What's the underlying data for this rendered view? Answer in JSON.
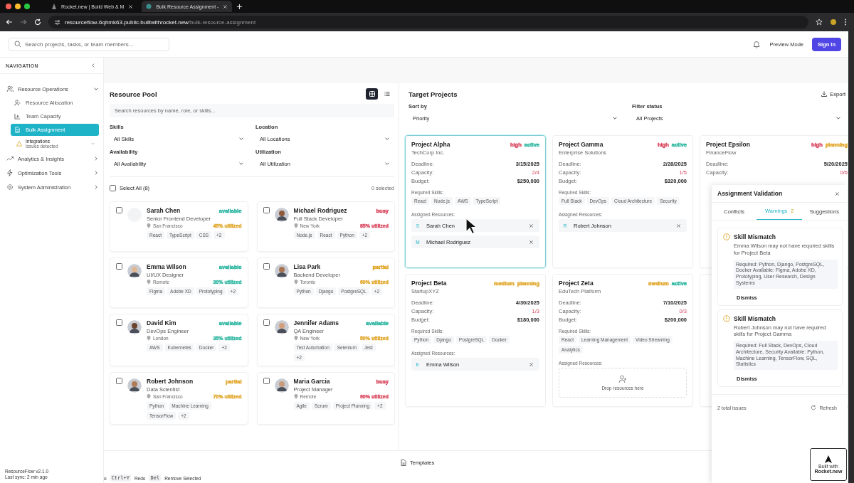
{
  "browser": {
    "tabs": [
      {
        "title": "Rocket.new | Build Web & M",
        "selected": false
      },
      {
        "title": "Bulk Resource Assignment -",
        "selected": true
      }
    ],
    "url_host": "resourceflow-6qhmk63.public.builtwithrocket.new",
    "url_path": "/bulk-resource-assignment"
  },
  "header": {
    "search_placeholder": "Search projects, tasks, or team members...",
    "preview_label": "Preview Mode",
    "sign_in": "Sign In"
  },
  "sidebar": {
    "heading": "NAVIGATION",
    "items": [
      {
        "label": "Resource Operations",
        "expanded": true,
        "children": [
          {
            "label": "Resource Allocation",
            "selected": false
          },
          {
            "label": "Team Capacity",
            "selected": false
          },
          {
            "label": "Bulk Assignment",
            "selected": true
          }
        ],
        "notice": {
          "title": "Integrations",
          "subtitle": "Issues detected"
        }
      },
      {
        "label": "Analytics & Insights",
        "expanded": false
      },
      {
        "label": "Optimization Tools",
        "expanded": false
      },
      {
        "label": "System Administration",
        "expanded": false
      }
    ],
    "version": "ResourceFlow v2.1.0",
    "sync": "Last sync: 2 min ago"
  },
  "resource_pool": {
    "title": "Resource Pool",
    "views": [
      {
        "selected": true
      },
      {
        "selected": false
      }
    ],
    "search_placeholder": "Search resources by name, role, or skills...",
    "filters": [
      {
        "label": "Skills",
        "value": "All Skills"
      },
      {
        "label": "Location",
        "value": "All Locations"
      },
      {
        "label": "Availability",
        "value": "All Availability"
      },
      {
        "label": "Utilization",
        "value": "All Utilization"
      }
    ],
    "select_all": {
      "label": "Select All (8)",
      "checked": false
    },
    "selected_count": "0 selected",
    "resources": [
      {
        "name": "Sarah Chen",
        "role": "Senior Frontend Developer",
        "location": "San Francisco",
        "status": {
          "text": "available",
          "color": "#2bb5a0"
        },
        "utilization": {
          "text": "45% utilized",
          "color": "#e0a526"
        },
        "skills": [
          "React",
          "TypeScript",
          "CSS",
          "+2"
        ],
        "photo": false,
        "checked": false
      },
      {
        "name": "Michael Rodriguez",
        "role": "Full Stack Developer",
        "location": "New York",
        "status": {
          "text": "busy",
          "color": "#d9485f"
        },
        "utilization": {
          "text": "85% utilized",
          "color": "#d9485f"
        },
        "skills": [
          "Node.js",
          "React",
          "Python",
          "+2"
        ],
        "photo": true,
        "checked": false
      },
      {
        "name": "Emma Wilson",
        "role": "UI/UX Designer",
        "location": "Remote",
        "status": {
          "text": "available",
          "color": "#2bb5a0"
        },
        "utilization": {
          "text": "30% utilized",
          "color": "#2bb5a0"
        },
        "skills": [
          "Figma",
          "Adobe XD",
          "Prototyping",
          "+2"
        ],
        "photo": true,
        "checked": false
      },
      {
        "name": "Lisa Park",
        "role": "Backend Developer",
        "location": "Toronto",
        "status": {
          "text": "partial",
          "color": "#e0a526"
        },
        "utilization": {
          "text": "60% utilized",
          "color": "#e0a526"
        },
        "skills": [
          "Python",
          "Django",
          "PostgreSQL",
          "+2"
        ],
        "photo": true,
        "checked": false
      },
      {
        "name": "David Kim",
        "role": "DevOps Engineer",
        "location": "London",
        "status": {
          "text": "available",
          "color": "#2bb5a0"
        },
        "utilization": {
          "text": "35% utilized",
          "color": "#2bb5a0"
        },
        "skills": [
          "AWS",
          "Kubernetes",
          "Docker",
          "+2"
        ],
        "photo": true,
        "checked": false
      },
      {
        "name": "Jennifer Adams",
        "role": "QA Engineer",
        "location": "New York",
        "status": {
          "text": "available",
          "color": "#2bb5a0"
        },
        "utilization": {
          "text": "50% utilized",
          "color": "#e0a526"
        },
        "skills": [
          "Test Automation",
          "Selenium",
          "Jest",
          "+2"
        ],
        "photo": true,
        "checked": false
      },
      {
        "name": "Robert Johnson",
        "role": "Data Scientist",
        "location": "San Francisco",
        "status": {
          "text": "partial",
          "color": "#e0a526"
        },
        "utilization": {
          "text": "70% utilized",
          "color": "#e0a526"
        },
        "skills": [
          "Python",
          "Machine Learning",
          "TensorFlow",
          "+2"
        ],
        "photo": true,
        "checked": false
      },
      {
        "name": "Maria Garcia",
        "role": "Project Manager",
        "location": "Remote",
        "status": {
          "text": "busy",
          "color": "#d9485f"
        },
        "utilization": {
          "text": "90% utilized",
          "color": "#d9485f"
        },
        "skills": [
          "Agile",
          "Scrum",
          "Project Planning",
          "+2"
        ],
        "photo": true,
        "checked": false
      }
    ]
  },
  "target_projects": {
    "title": "Target Projects",
    "export": "Export",
    "sort_label": "Sort by",
    "sort_value": "Priority",
    "filter_label": "Filter status",
    "filter_value": "All Projects",
    "projects": [
      {
        "name": "Project Alpha",
        "client": "TechCorp Inc.",
        "priority": {
          "text": "high",
          "color": "#d9485f"
        },
        "status": {
          "text": "active",
          "color": "#2bb5a0"
        },
        "selected": true,
        "fields": [
          {
            "label": "Deadline:",
            "value": "3/15/2025"
          },
          {
            "label": "Capacity:",
            "value": "2/4"
          },
          {
            "label": "Budget:",
            "value": "$250,000"
          }
        ],
        "skills_label": "Required Skills:",
        "skills": [
          "React",
          "Node.js",
          "AWS",
          "TypeScript"
        ],
        "assigned_label": "Assigned Resources:",
        "assigned": [
          {
            "initial": "S",
            "name": "Sarah Chen"
          },
          {
            "initial": "M",
            "name": "Michael Rodriguez"
          }
        ]
      },
      {
        "name": "Project Gamma",
        "client": "Enterprise Solutions",
        "priority": {
          "text": "high",
          "color": "#d9485f"
        },
        "status": {
          "text": "active",
          "color": "#2bb5a0"
        },
        "selected": false,
        "fields": [
          {
            "label": "Deadline:",
            "value": "2/28/2025"
          },
          {
            "label": "Capacity:",
            "value": "1/5"
          },
          {
            "label": "Budget:",
            "value": "$320,000"
          }
        ],
        "skills_label": "Required Skills:",
        "skills": [
          "Full Stack",
          "DevOps",
          "Cloud Architecture",
          "Security"
        ],
        "assigned_label": "Assigned Resources:",
        "assigned": [
          {
            "initial": "R",
            "name": "Robert Johnson"
          }
        ]
      },
      {
        "name": "Project Epsilon",
        "client": "FinanceFlow",
        "priority": {
          "text": "high",
          "color": "#d9485f"
        },
        "status": {
          "text": "planning",
          "color": "#e0a526"
        },
        "selected": false,
        "fields": [
          {
            "label": "Deadline:",
            "value": "5/20/2025"
          },
          {
            "label": "Capacity:",
            "value": "0/6"
          }
        ]
      },
      {
        "name": "Project Beta",
        "client": "StartupXYZ",
        "priority": {
          "text": "medium",
          "color": "#e0a526"
        },
        "status": {
          "text": "planning",
          "color": "#e0a526"
        },
        "selected": false,
        "fields": [
          {
            "label": "Deadline:",
            "value": "4/30/2025"
          },
          {
            "label": "Capacity:",
            "value": "1/3"
          },
          {
            "label": "Budget:",
            "value": "$180,000"
          }
        ],
        "skills_label": "Required Skills:",
        "skills": [
          "Python",
          "Django",
          "PostgreSQL",
          "Docker"
        ],
        "assigned_label": "Assigned Resources:",
        "assigned": [
          {
            "initial": "E",
            "name": "Emma Wilson"
          }
        ]
      },
      {
        "name": "Project Zeta",
        "client": "EduTech Platform",
        "priority": {
          "text": "medium",
          "color": "#e0a526"
        },
        "status": {
          "text": "active",
          "color": "#2bb5a0"
        },
        "selected": false,
        "fields": [
          {
            "label": "Deadline:",
            "value": "7/10/2025"
          },
          {
            "label": "Capacity:",
            "value": "0/3"
          },
          {
            "label": "Budget:",
            "value": "$200,000"
          }
        ],
        "skills_label": "Required Skills:",
        "skills": [
          "React",
          "Learning Management",
          "Video Streaming",
          "Analytics"
        ],
        "assigned_label": "Assigned Resources:",
        "drop_hint": "Drop resources here"
      }
    ]
  },
  "validation": {
    "title": "Assignment Validation",
    "tabs": [
      {
        "label": "Conflicts",
        "selected": false
      },
      {
        "label": "Warnings",
        "badge": "2",
        "selected": true
      },
      {
        "label": "Suggestions",
        "selected": false
      }
    ],
    "warnings": [
      {
        "title": "Skill Mismatch",
        "message": "Emma Wilson may not have required skills for Project Beta",
        "details": "Required: Python, Django, PostgreSQL, Docker Available: Figma, Adobe XD, Prototyping, User Research, Design Systems",
        "action": "Dismiss"
      },
      {
        "title": "Skill Mismatch",
        "message": "Robert Johnson may not have required skills for Project Gamma",
        "details": "Required: Full Stack, DevOps, Cloud Architecture, Security Available: Python, Machine Learning, TensorFlow, SQL, Statistics",
        "action": "Dismiss"
      }
    ],
    "total": "2 total issues",
    "refresh": "Refresh"
  },
  "footer": {
    "templates": "Templates",
    "shortcuts": [
      {
        "kind": "label",
        "text": "o"
      },
      {
        "kind": "key",
        "text": "Ctrl+Y"
      },
      {
        "kind": "label",
        "text": "Redo"
      },
      {
        "kind": "key",
        "text": "Del"
      },
      {
        "kind": "label",
        "text": "Remove Selected"
      }
    ]
  },
  "badge": {
    "line1": "Built with",
    "line2": "Rocket.new"
  }
}
